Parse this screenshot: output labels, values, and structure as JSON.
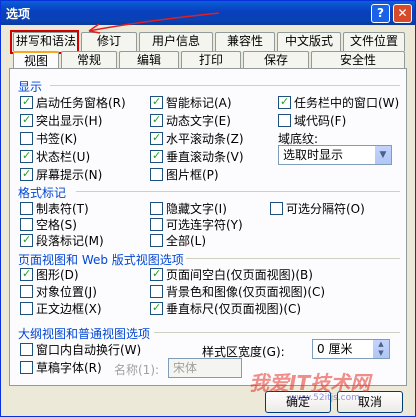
{
  "window": {
    "title": "选项",
    "help_glyph": "?",
    "close_glyph": "✕"
  },
  "tabs_top": [
    {
      "label": "拼写和语法",
      "active": false
    },
    {
      "label": "修订"
    },
    {
      "label": "用户信息"
    },
    {
      "label": "兼容性"
    },
    {
      "label": "中文版式"
    },
    {
      "label": "文件位置"
    }
  ],
  "tabs_bottom": [
    {
      "label": "视图",
      "active": true
    },
    {
      "label": "常规"
    },
    {
      "label": "编辑"
    },
    {
      "label": "打印"
    },
    {
      "label": "保存"
    },
    {
      "label": "安全性"
    }
  ],
  "sections": {
    "display": "显示",
    "format_marks": "格式标记",
    "page_web": "页面视图和 Web 版式视图选项",
    "outline": "大纲视图和普通视图选项"
  },
  "display_options": [
    {
      "label": "启动任务窗格(R)",
      "checked": true
    },
    {
      "label": "智能标记(A)",
      "checked": true
    },
    {
      "label": "任务栏中的窗口(W)",
      "checked": true
    },
    {
      "label": "突出显示(H)",
      "checked": true
    },
    {
      "label": "动态文字(E)",
      "checked": true
    },
    {
      "label": "域代码(F)",
      "checked": false
    },
    {
      "label": "书签(K)",
      "checked": false
    },
    {
      "label": "水平滚动条(Z)",
      "checked": true
    },
    {
      "label": "状态栏(U)",
      "checked": true
    },
    {
      "label": "垂直滚动条(V)",
      "checked": true
    },
    {
      "label": "屏幕提示(N)",
      "checked": true
    },
    {
      "label": "图片框(P)",
      "checked": false
    }
  ],
  "field_shading": {
    "label": "域底纹:",
    "value": "选取时显示"
  },
  "format_options": [
    {
      "label": "制表符(T)",
      "checked": false
    },
    {
      "label": "隐藏文字(I)",
      "checked": false
    },
    {
      "label": "可选分隔符(O)",
      "checked": false
    },
    {
      "label": "空格(S)",
      "checked": false
    },
    {
      "label": "可选连字符(Y)",
      "checked": false
    },
    {
      "label": "段落标记(M)",
      "checked": true
    },
    {
      "label": "全部(L)",
      "checked": false
    }
  ],
  "page_options": [
    {
      "label": "图形(D)",
      "checked": true
    },
    {
      "label": "页面间空白(仅页面视图)(B)",
      "checked": true
    },
    {
      "label": "对象位置(J)",
      "checked": false
    },
    {
      "label": "背景色和图像(仅页面视图)(C)",
      "checked": false
    },
    {
      "label": "正文边框(X)",
      "checked": false
    },
    {
      "label": "垂直标尺(仅页面视图)(C)",
      "checked": true
    }
  ],
  "outline_options": [
    {
      "label": "窗口内自动换行(W)",
      "checked": false
    },
    {
      "label": "草稿字体(R)",
      "checked": false
    }
  ],
  "style_width": {
    "label": "样式区宽度(G):",
    "value": "0 厘米"
  },
  "draft_font": {
    "name_label": "名称(1):",
    "name_value": "宋体"
  },
  "buttons": {
    "ok": "确定",
    "cancel": "取消"
  },
  "watermark": {
    "text": "我爱IT技术网",
    "url": "www.52itjs.com"
  }
}
